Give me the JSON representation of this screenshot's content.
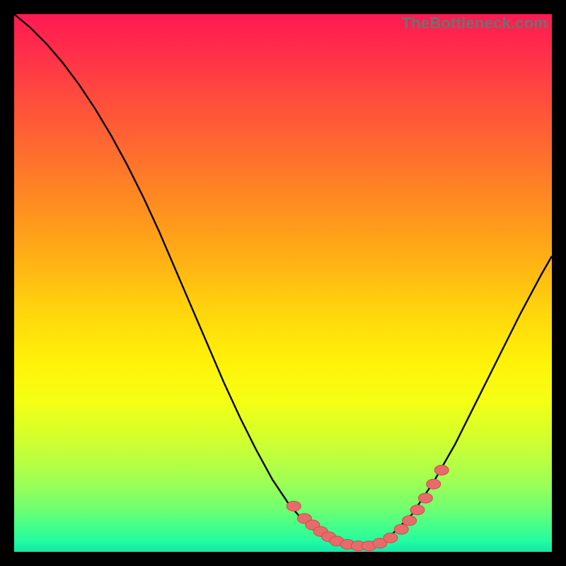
{
  "watermark": {
    "text": "TheBottleneck.com"
  },
  "colors": {
    "page_bg": "#000000",
    "gradient_top": "#ff1a52",
    "gradient_bottom": "#14e6a8",
    "curve_stroke": "#000000",
    "marker_fill": "#e86a6a",
    "marker_stroke": "#c94f4f"
  },
  "chart_data": {
    "type": "line",
    "title": "",
    "xlabel": "",
    "ylabel": "",
    "xlim": [
      0,
      100
    ],
    "ylim": [
      0,
      100
    ],
    "grid": false,
    "series": [
      {
        "name": "curve",
        "x": [
          0,
          3,
          6,
          9,
          12,
          15,
          18,
          21,
          24,
          27,
          30,
          33,
          36,
          39,
          42,
          45,
          48,
          51,
          54,
          57,
          60,
          62,
          64,
          66,
          68,
          70,
          74,
          78,
          82,
          86,
          90,
          94,
          98,
          100
        ],
        "y": [
          100,
          97.5,
          94.5,
          91,
          87,
          82.5,
          77.5,
          72,
          66,
          59.5,
          52.5,
          45.5,
          38.5,
          31.5,
          25,
          19,
          13.5,
          9,
          5.5,
          3,
          1.5,
          1,
          1,
          1.2,
          1.8,
          3,
          7,
          13,
          20,
          28,
          36,
          44,
          51.5,
          55
        ]
      }
    ],
    "markers": {
      "name": "highlighted-points",
      "x": [
        52,
        54,
        55.5,
        57,
        58.5,
        60,
        62,
        64,
        66,
        68,
        70,
        72,
        73.5,
        75,
        76.5,
        78,
        79.5
      ],
      "y": [
        8.5,
        6.2,
        5.0,
        3.8,
        2.8,
        2.0,
        1.4,
        1.1,
        1.1,
        1.6,
        2.6,
        4.2,
        5.8,
        7.8,
        10.0,
        12.6,
        15.2
      ]
    }
  }
}
